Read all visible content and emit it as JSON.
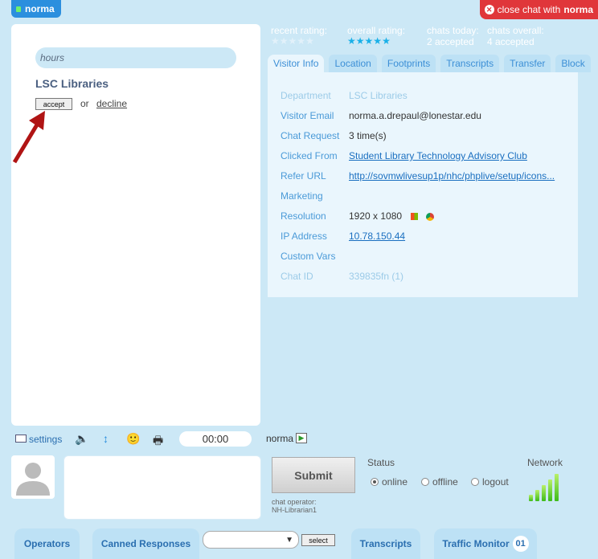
{
  "chat_tab": {
    "name": "norma"
  },
  "close_chat": {
    "prefix": "close chat with",
    "name": "norma"
  },
  "left": {
    "hours_label": "hours",
    "department": "LSC Libraries",
    "accept_label": "accept",
    "or_label": "or",
    "decline_label": "decline"
  },
  "stats": {
    "recent_rating_label": "recent rating:",
    "recent_rating_value": 0,
    "overall_rating_label": "overall rating:",
    "overall_rating_value": 5,
    "chats_today_label": "chats today:",
    "chats_today_value": "2 accepted",
    "chats_overall_label": "chats overall:",
    "chats_overall_value": "4 accepted"
  },
  "tabs": [
    "Visitor Info",
    "Location",
    "Footprints",
    "Transcripts",
    "Transfer",
    "Block"
  ],
  "visitor": {
    "rows": [
      {
        "label": "Department",
        "value": "LSC Libraries",
        "faint": true
      },
      {
        "label": "Visitor Email",
        "value": "norma.a.drepaul@lonestar.edu"
      },
      {
        "label": "Chat Request",
        "value": "3 time(s)"
      },
      {
        "label": "Clicked From",
        "value": "Student Library Technology Advisory Club",
        "link": true
      },
      {
        "label": "Refer URL",
        "value": "http://sovmwlivesup1p/nhc/phplive/setup/icons...",
        "link": true
      },
      {
        "label": "Marketing",
        "value": ""
      },
      {
        "label": "Resolution",
        "value": "1920 x 1080"
      },
      {
        "label": "IP Address",
        "value": "10.78.150.44",
        "link": true
      },
      {
        "label": "Custom Vars",
        "value": ""
      },
      {
        "label": "Chat ID",
        "value": "339835fn   (1)",
        "faint": true
      }
    ]
  },
  "toolbar": {
    "settings_label": "settings",
    "timer": "00:00",
    "operator_name": "norma"
  },
  "compose": {
    "submit_label": "Submit",
    "chat_operator_label": "chat operator:",
    "chat_operator_value": "NH-Librarian1"
  },
  "status": {
    "label": "Status",
    "options": [
      "online",
      "offline",
      "logout"
    ],
    "selected": "online"
  },
  "network": {
    "label": "Network",
    "level": 5
  },
  "bottom": {
    "operators_label": "Operators",
    "canned_label": "Canned Responses",
    "select_label": "select",
    "transcripts_label": "Transcripts",
    "traffic_label": "Traffic Monitor",
    "traffic_count": "01"
  },
  "colors": {
    "accent": "#2b8fde",
    "danger": "#e0363a",
    "background": "#cce8f6"
  }
}
